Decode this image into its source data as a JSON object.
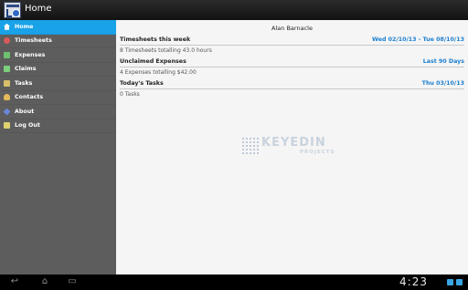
{
  "app": {
    "title": "Home"
  },
  "sidebar": {
    "items": [
      {
        "label": "Home",
        "icon": "home-icon",
        "color": "#ffffff",
        "active": true
      },
      {
        "label": "Timesheets",
        "icon": "clock-icon",
        "color": "#d85a5a"
      },
      {
        "label": "Expenses",
        "icon": "expenses-icon",
        "color": "#6ec16e"
      },
      {
        "label": "Claims",
        "icon": "claims-icon",
        "color": "#7ccf7c"
      },
      {
        "label": "Tasks",
        "icon": "tasks-icon",
        "color": "#d7c06a"
      },
      {
        "label": "Contacts",
        "icon": "contacts-icon",
        "color": "#e6b95c"
      },
      {
        "label": "About",
        "icon": "about-icon",
        "color": "#6a86d9"
      },
      {
        "label": "Log Out",
        "icon": "logout-icon",
        "color": "#e0d271"
      }
    ]
  },
  "content": {
    "user_name": "Alan Barnacle",
    "sections": [
      {
        "title": "Timesheets this week",
        "right": "Wed 02/10/13 - Tue 08/10/13",
        "detail": "8 Timesheets totalling 43.0 hours"
      },
      {
        "title": "Unclaimed Expenses",
        "right": "Last 90 Days",
        "detail": "4 Expenses totalling $42.00"
      },
      {
        "title": "Today's Tasks",
        "right": "Thu 03/10/13",
        "detail": "0 Tasks"
      }
    ],
    "logo": {
      "main": "KEYEDIN",
      "sub": "PROJECTS"
    }
  },
  "navbar": {
    "time": "4:23",
    "back_icon": "back-icon",
    "home_icon": "home-nav-icon",
    "recent_icon": "recent-apps-icon"
  }
}
